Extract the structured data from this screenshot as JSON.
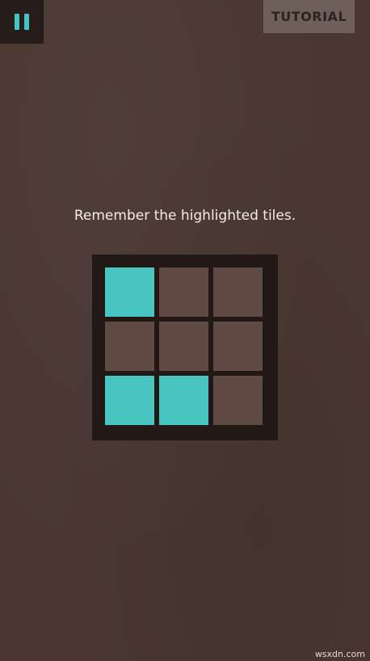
{
  "header": {
    "pause_icon": "pause-icon",
    "tutorial_label": "TUTORIAL"
  },
  "main": {
    "instruction": "Remember the highlighted tiles.",
    "grid": {
      "rows": 3,
      "cols": 3,
      "highlighted": [
        [
          true,
          false,
          false
        ],
        [
          false,
          false,
          false
        ],
        [
          true,
          true,
          false
        ]
      ]
    }
  },
  "watermark": "wsxdn.com",
  "colors": {
    "background": "#4a3731",
    "highlight": "#48c4c1",
    "tile": "#614a43",
    "board": "#221816",
    "accent": "#46c3c3"
  }
}
